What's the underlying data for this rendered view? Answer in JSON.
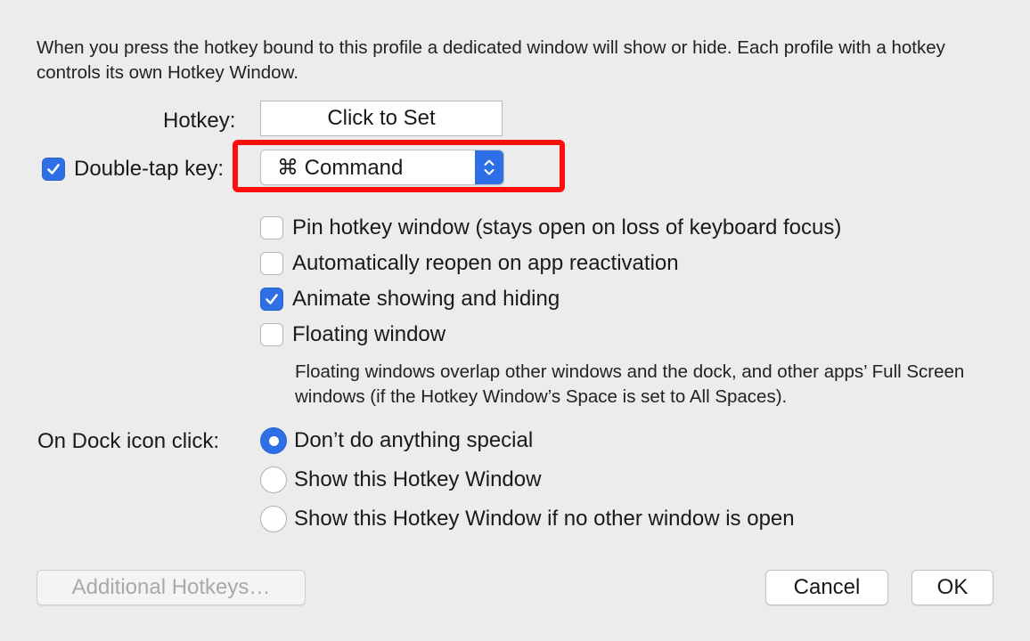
{
  "description": "When you press the hotkey bound to this profile a dedicated window will show or hide. Each profile with a hotkey controls its own Hotkey Window.",
  "hotkey": {
    "label": "Hotkey:",
    "button": "Click to Set"
  },
  "double_tap": {
    "label": "Double-tap key:",
    "checked": true,
    "selected_key": "⌘ Command"
  },
  "options": [
    {
      "label": "Pin hotkey window (stays open on loss of keyboard focus)",
      "checked": false
    },
    {
      "label": "Automatically reopen on app reactivation",
      "checked": false
    },
    {
      "label": "Animate showing and hiding",
      "checked": true
    },
    {
      "label": "Floating window",
      "checked": false
    }
  ],
  "floating_help": "Floating windows overlap other windows and the dock, and other apps’ Full Screen windows (if the Hotkey Window’s Space is set to All Spaces).",
  "dock": {
    "label": "On Dock icon click:",
    "choices": [
      {
        "label": "Don’t do anything special",
        "selected": true
      },
      {
        "label": "Show this Hotkey Window",
        "selected": false
      },
      {
        "label": "Show this Hotkey Window if no other window is open",
        "selected": false
      }
    ]
  },
  "buttons": {
    "additional": "Additional Hotkeys…",
    "cancel": "Cancel",
    "ok": "OK"
  },
  "colors": {
    "accent": "#2f6fe6",
    "highlight": "#ff0c0c",
    "background": "#ececec"
  }
}
